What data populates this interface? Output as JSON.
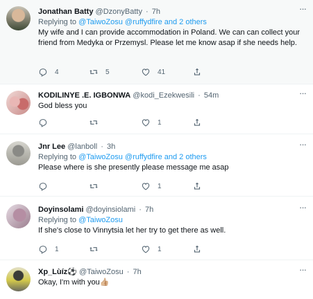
{
  "tweets": [
    {
      "name": "Jonathan Batty",
      "handle": "@DzonyBatty",
      "time": "7h",
      "replying_prefix": "Replying to",
      "replying_to": "@TaiwoZosu",
      "replying_to_2": "@ruffydfire",
      "replying_suffix": "and 2 others",
      "text": "My wife and I can provide accommodation in Poland. We can can collect your friend from Medyka or Przemysl. Please let me know asap if she needs help.",
      "replies": "4",
      "retweets": "5",
      "likes": "41"
    },
    {
      "name": "KODILINYE .E. IGBONWA",
      "handle": "@kodi_Ezekwesili",
      "time": "54m",
      "text": "God bless you",
      "replies": "",
      "retweets": "",
      "likes": "1"
    },
    {
      "name": "Jnr Lee",
      "handle": "@lanboll",
      "time": "3h",
      "replying_prefix": "Replying to",
      "replying_to": "@TaiwoZosu",
      "replying_to_2": "@ruffydfire",
      "replying_suffix": "and 2 others",
      "text": "Please where is she presently please message me asap",
      "replies": "",
      "retweets": "",
      "likes": "1"
    },
    {
      "name": "Doyinsolami",
      "handle": "@doyinsiolami",
      "time": "7h",
      "replying_prefix": "Replying to",
      "replying_to": "@TaiwoZosu",
      "text": "If she's close to Vinnytsia let her try to get there as well.",
      "replies": "1",
      "retweets": "",
      "likes": "1"
    },
    {
      "name": "Xp_Lùíz⚽",
      "handle": "@TaiwoZosu",
      "time": "7h",
      "text": "Okay, I'm with you👍🏼"
    }
  ],
  "dot": "·",
  "more_glyph": "···"
}
